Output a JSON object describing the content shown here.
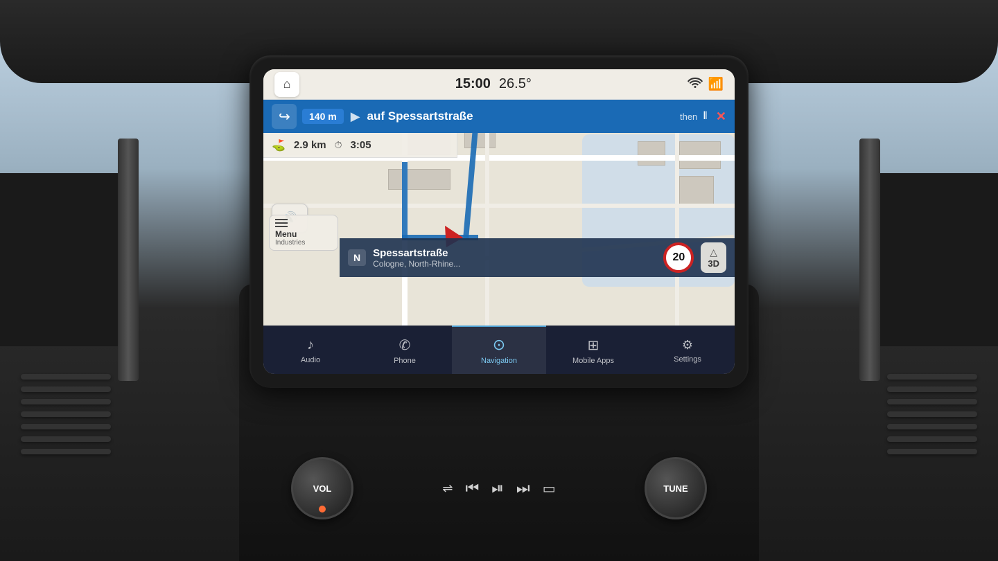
{
  "background": {
    "color": "#b8cfe0"
  },
  "status_bar": {
    "home_icon": "⌂",
    "time": "15:00",
    "temperature": "26.5°",
    "wifi_icon": "wifi",
    "bluetooth_icon": "bluetooth"
  },
  "nav_instruction": {
    "turn_icon": "↰",
    "distance": "140 m",
    "street": "auf Spessartstraße",
    "then_label": "then",
    "next_icon": "⟿",
    "close_icon": "✕"
  },
  "nav_info": {
    "finish_icon": "⛳",
    "total_distance": "2.9 km",
    "clock_icon": "🕐",
    "eta": "3:05"
  },
  "map": {
    "volume_icon": "🔊",
    "compass": "N",
    "current_street": "Spessartstraße",
    "city": "Cologne, North-Rhine...",
    "speed_limit": "20",
    "view_btn": "3D"
  },
  "menu": {
    "icon": "≡",
    "label": "Menu",
    "sublabel": "Industries"
  },
  "bottom_nav": {
    "items": [
      {
        "id": "audio",
        "icon": "♪",
        "label": "Audio",
        "active": false
      },
      {
        "id": "phone",
        "icon": "✆",
        "label": "Phone",
        "active": false
      },
      {
        "id": "navigation",
        "icon": "⊙",
        "label": "Navigation",
        "active": true
      },
      {
        "id": "mobile-apps",
        "icon": "⊞",
        "label": "Mobile Apps",
        "active": false
      },
      {
        "id": "settings",
        "icon": "≡=",
        "label": "Settings",
        "active": false
      }
    ]
  },
  "controls": {
    "vol_label": "VOL",
    "tune_label": "TUNE",
    "buttons": [
      {
        "id": "eq",
        "icon": "⇌",
        "label": "eq"
      },
      {
        "id": "prev",
        "icon": "⏮",
        "label": "prev"
      },
      {
        "id": "play",
        "icon": "⏯",
        "label": "play"
      },
      {
        "id": "next",
        "icon": "⏭",
        "label": "next"
      },
      {
        "id": "screen",
        "icon": "▭",
        "label": "screen"
      }
    ]
  }
}
